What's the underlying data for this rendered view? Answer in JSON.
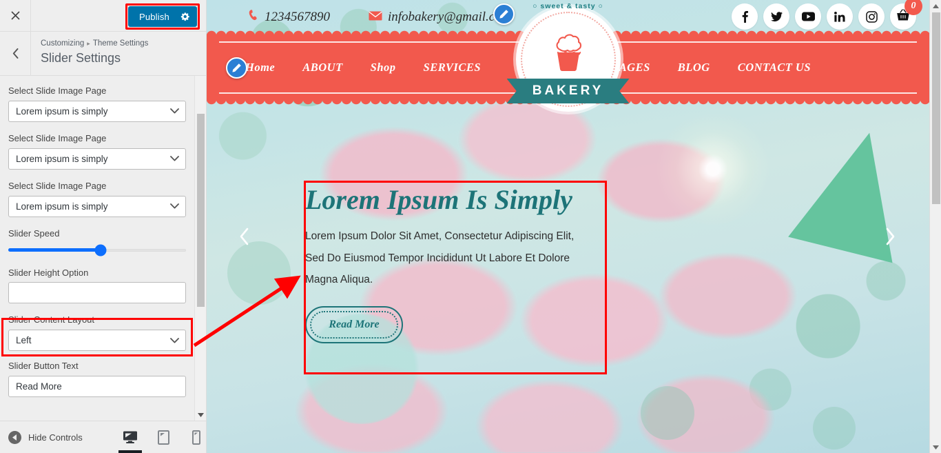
{
  "customizer": {
    "close_icon": "close-icon",
    "publish_label": "Publish",
    "gear_icon": "gear-icon",
    "back_icon": "chevron-left-icon",
    "breadcrumb_root": "Customizing",
    "breadcrumb_sep": "▸",
    "breadcrumb_parent": "Theme Settings",
    "page_title": "Slider Settings",
    "controls": [
      {
        "label": "Select Slide Image Page",
        "type": "select",
        "value": "Lorem ipsum is simply"
      },
      {
        "label": "Select Slide Image Page",
        "type": "select",
        "value": "Lorem ipsum is simply"
      },
      {
        "label": "Select Slide Image Page",
        "type": "select",
        "value": "Lorem ipsum is simply"
      },
      {
        "label": "Slider Speed",
        "type": "range",
        "percent": 52
      },
      {
        "label": "Slider Height Option",
        "type": "text",
        "value": ""
      },
      {
        "label": "Slider Content Layout",
        "type": "select",
        "value": "Left"
      },
      {
        "label": "Slider Button Text",
        "type": "text",
        "value": "Read More"
      }
    ],
    "footer": {
      "hide_controls_label": "Hide Controls",
      "devices": [
        {
          "name": "desktop",
          "active": true
        },
        {
          "name": "tablet",
          "active": false
        },
        {
          "name": "mobile",
          "active": false
        }
      ]
    },
    "highlight_color": "#ff0000",
    "accent_color": "#0073aa"
  },
  "preview": {
    "topbar": {
      "phone_icon": "phone-icon",
      "phone": "1234567890",
      "mail_icon": "envelope-icon",
      "email": "infobakery@gmail.com",
      "social": [
        {
          "name": "facebook",
          "glyph": "f"
        },
        {
          "name": "twitter",
          "glyph": "✉"
        },
        {
          "name": "youtube",
          "glyph": "▶"
        },
        {
          "name": "linkedin",
          "glyph": "in"
        },
        {
          "name": "instagram",
          "glyph": "◎"
        }
      ],
      "cart_icon": "shopping-basket-icon",
      "cart_count": "0"
    },
    "logo": {
      "tagline": "○ sweet & tasty ○",
      "name": "BAKERY",
      "mark": "cupcake-icon"
    },
    "nav_left": [
      "Home",
      "ABOUT",
      "Shop",
      "SERVICES"
    ],
    "nav_right": [
      "PAGES",
      "BLOG",
      "CONTACT US"
    ],
    "slide": {
      "title": "Lorem Ipsum Is Simply",
      "description": "Lorem Ipsum Dolor Sit Amet, Consectetur Adipiscing Elit, Sed Do Eiusmod Tempor Incididunt Ut Labore Et Dolore Magna Aliqua.",
      "button_label": "Read More",
      "prev_icon": "chevron-left-icon",
      "next_icon": "chevron-right-icon"
    },
    "brand_red": "#f2594d",
    "brand_teal": "#1d7478"
  }
}
